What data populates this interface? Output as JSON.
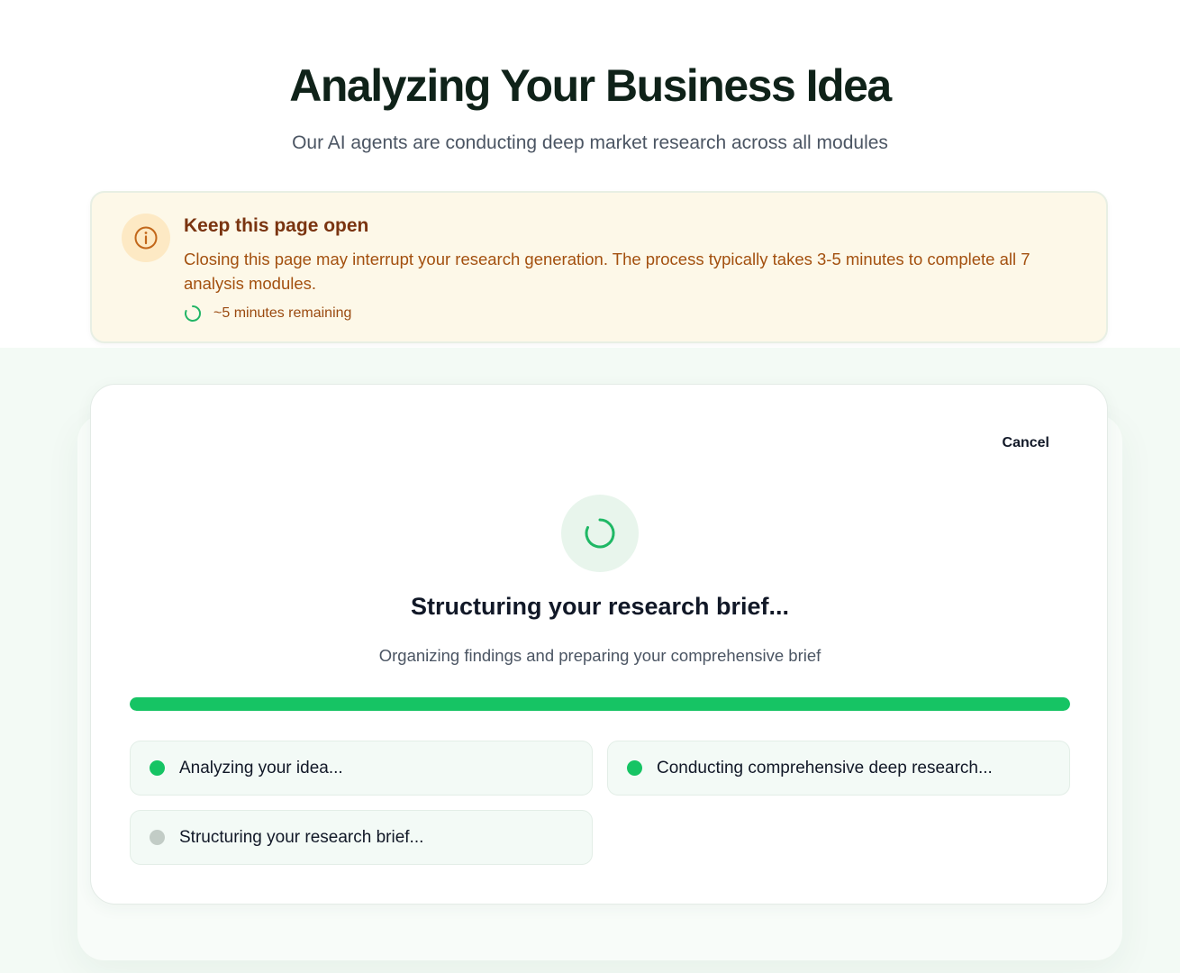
{
  "header": {
    "title": "Analyzing Your Business Idea",
    "subtitle": "Our AI agents are conducting deep market research across all modules"
  },
  "notice": {
    "icon": "info-icon",
    "title": "Keep this page open",
    "body": "Closing this page may interrupt your research generation. The process typically takes 3-5 minutes to complete all 7 analysis modules.",
    "time_remaining": "~5 minutes remaining"
  },
  "card": {
    "cancel_label": "Cancel",
    "stage_title": "Structuring your research brief...",
    "stage_description": "Organizing findings and preparing your comprehensive brief",
    "progress_percent": 100,
    "steps": [
      {
        "label": "Analyzing your idea...",
        "status": "complete"
      },
      {
        "label": "Conducting comprehensive deep research...",
        "status": "complete"
      },
      {
        "label": "Structuring your research brief...",
        "status": "pending"
      }
    ]
  },
  "colors": {
    "accent_green": "#16c464",
    "pending_gray": "#c2ccc6",
    "notice_bg": "#fdf8e8",
    "notice_title": "#7a3410",
    "notice_text": "#a3500f"
  }
}
